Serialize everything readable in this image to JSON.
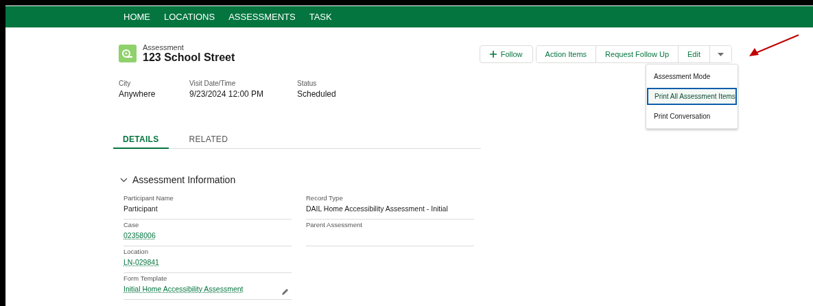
{
  "nav": {
    "items": [
      {
        "label": "HOME"
      },
      {
        "label": "LOCATIONS"
      },
      {
        "label": "ASSESSMENTS"
      },
      {
        "label": "TASK"
      }
    ]
  },
  "record": {
    "type_label": "Assessment",
    "title": "123 School Street"
  },
  "actions": [
    {
      "label": "Follow",
      "kind": "follow"
    },
    {
      "label": "Action Items",
      "kind": "plain"
    },
    {
      "label": "Request Follow Up",
      "kind": "plain"
    },
    {
      "label": "Edit",
      "kind": "plain"
    },
    {
      "kind": "menu",
      "expanded": true
    }
  ],
  "menu": {
    "items": [
      {
        "label": "Assessment Mode",
        "selected": false
      },
      {
        "label": "Print All Assessment Items",
        "selected": true
      },
      {
        "label": "Print Conversation",
        "selected": false
      }
    ]
  },
  "highlights": [
    {
      "label": "City",
      "value": "Anywhere"
    },
    {
      "label": "Visit Date/Time",
      "value": "9/23/2024 12:00 PM"
    },
    {
      "label": "Status",
      "value": "Scheduled"
    }
  ],
  "tabs": [
    {
      "label": "DETAILS",
      "selected": true
    },
    {
      "label": "RELATED",
      "selected": false
    }
  ],
  "section": {
    "title": "Assessment Information",
    "expanded": true
  },
  "fields": {
    "left": [
      {
        "label": "Participant Name",
        "value": "Participant",
        "kind": "text"
      },
      {
        "label": "Case",
        "value": "02358006",
        "kind": "link"
      },
      {
        "label": "Location",
        "value": "LN-029841",
        "kind": "link"
      },
      {
        "label": "Form Template",
        "value": "Initial Home Accessibility Assessment",
        "kind": "link",
        "editable": true
      }
    ],
    "right": [
      {
        "label": "Record Type",
        "value": "DAIL Home Accessibility Assessment - Initial",
        "kind": "text"
      },
      {
        "label": "Parent Assessment"
      }
    ]
  }
}
